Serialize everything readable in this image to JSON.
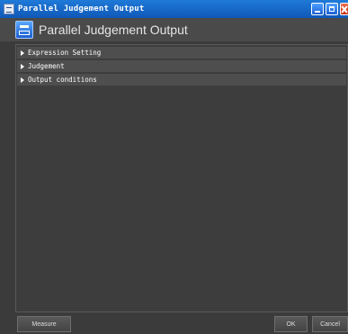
{
  "window": {
    "title": "Parallel Judgement Output"
  },
  "header": {
    "title": "Parallel Judgement Output"
  },
  "sections": [
    {
      "label": "Expression Setting",
      "expanded": false
    },
    {
      "label": "Judgement",
      "expanded": false
    },
    {
      "label": "Output conditions",
      "expanded": false
    }
  ],
  "footer": {
    "measure_label": "Measure",
    "ok_label": "OK",
    "cancel_label": "Cancel"
  }
}
